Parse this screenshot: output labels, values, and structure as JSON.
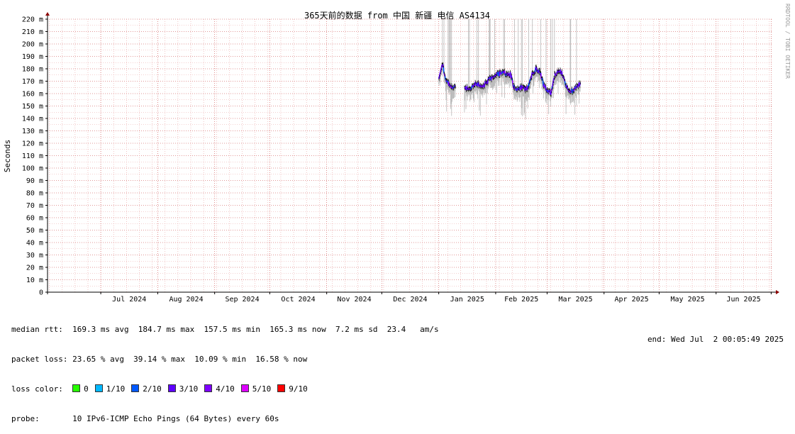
{
  "chart_data": {
    "type": "line",
    "title": "365天前的数据 from 中国 新疆 电信 AS4134",
    "ylabel": "Seconds",
    "watermark": "RRDTOOL / TOBI OETIKER",
    "ylim": [
      0,
      220
    ],
    "y_unit": "m",
    "y_ticks": [
      "0",
      "10 m",
      "20 m",
      "30 m",
      "40 m",
      "50 m",
      "60 m",
      "70 m",
      "80 m",
      "90 m",
      "100 m",
      "110 m",
      "120 m",
      "130 m",
      "140 m",
      "150 m",
      "160 m",
      "170 m",
      "180 m",
      "190 m",
      "200 m",
      "210 m",
      "220 m"
    ],
    "x_ticks": [
      "Jul 2024",
      "Aug 2024",
      "Sep 2024",
      "Oct 2024",
      "Nov 2024",
      "Dec 2024",
      "Jan 2025",
      "Feb 2025",
      "Mar 2025",
      "Apr 2025",
      "May 2025",
      "Jun 2025"
    ],
    "grid": true,
    "series": [
      {
        "name": "median rtt",
        "x": [
          "2025-01-01",
          "2025-01-03",
          "2025-01-05",
          "2025-01-08",
          "2025-01-10",
          "2025-01-13",
          "2025-01-15",
          "2025-01-18",
          "2025-01-20",
          "2025-01-22",
          "2025-01-25",
          "2025-01-27",
          "2025-01-29",
          "2025-02-01",
          "2025-02-03",
          "2025-02-05",
          "2025-02-07",
          "2025-02-09",
          "2025-02-11",
          "2025-02-13",
          "2025-02-15",
          "2025-02-17",
          "2025-02-19",
          "2025-02-21",
          "2025-02-23",
          "2025-02-25",
          "2025-02-27",
          "2025-03-01",
          "2025-03-03",
          "2025-03-05",
          "2025-03-07",
          "2025-03-09",
          "2025-03-11",
          "2025-03-13",
          "2025-03-15",
          "2025-03-17",
          "2025-03-19"
        ],
        "values": [
          172,
          184,
          170,
          166,
          165,
          null,
          165,
          164,
          167,
          168,
          166,
          169,
          172,
          175,
          176,
          178,
          175,
          176,
          165,
          164,
          165,
          163,
          166,
          176,
          180,
          178,
          167,
          163,
          160,
          175,
          178,
          177,
          168,
          163,
          162,
          166,
          168
        ]
      }
    ],
    "stats": {
      "median_rtt": "median rtt:  169.3 ms avg  184.7 ms max  157.5 ms min  165.3 ms now  7.2 ms sd  23.4   am/s",
      "packet_loss": "packet loss: 23.65 % avg  39.14 % max  10.09 % min  16.58 % now",
      "loss_color_label": "loss color:",
      "probe": "probe:       10 IPv6-ICMP Echo Pings (64 Bytes) every 60s",
      "end": "end: Wed Jul  2 00:05:49 2025"
    },
    "loss_legend": [
      {
        "label": "0",
        "color": "#26ff00"
      },
      {
        "label": "1/10",
        "color": "#00b8ff"
      },
      {
        "label": "2/10",
        "color": "#0059ff"
      },
      {
        "label": "3/10",
        "color": "#5e00ff"
      },
      {
        "label": "4/10",
        "color": "#7e00ff"
      },
      {
        "label": "5/10",
        "color": "#dd00ff"
      },
      {
        "label": "9/10",
        "color": "#ff0000"
      }
    ],
    "colors": {
      "grid_minor": "#e8a0a0",
      "grid_major": "#d06060",
      "smoke": "#b8b8b8",
      "median_line": "#2a0080",
      "axis": "#000000",
      "arrow": "#8b0000"
    }
  }
}
